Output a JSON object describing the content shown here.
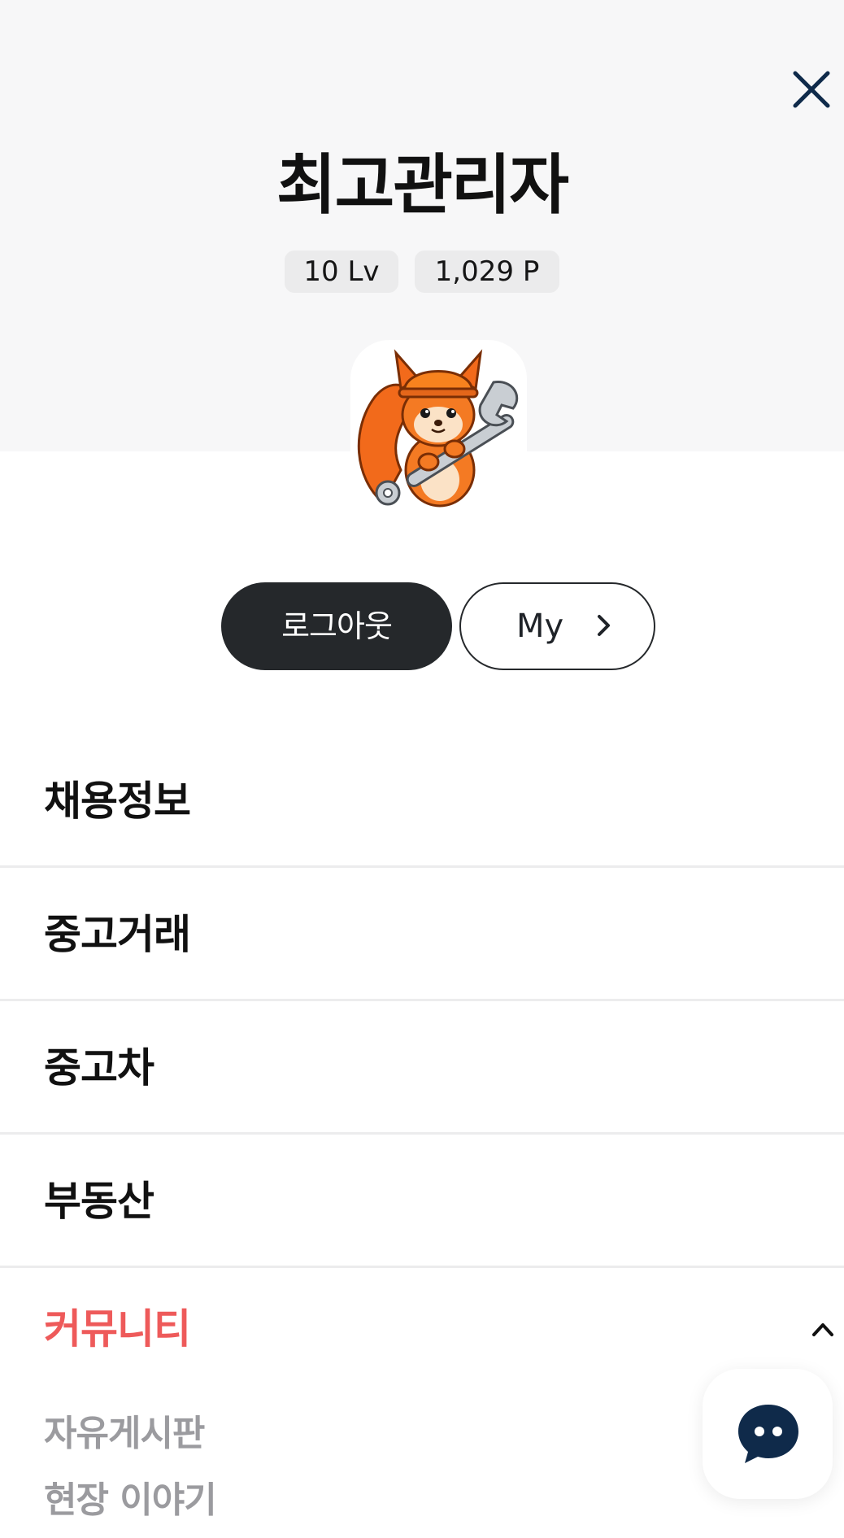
{
  "profile": {
    "username": "최고관리자",
    "level": "10 Lv",
    "points": "1,029 P"
  },
  "actions": {
    "logout_label": "로그아웃",
    "my_label": "My"
  },
  "menu": {
    "items": [
      {
        "label": "채용정보"
      },
      {
        "label": "중고거래"
      },
      {
        "label": "중고차"
      },
      {
        "label": "부동산"
      },
      {
        "label": "커뮤니티"
      }
    ],
    "community_sub": [
      {
        "label": "자유게시판"
      },
      {
        "label": "현장 이야기"
      }
    ]
  },
  "colors": {
    "accent": "#ee5a5a",
    "dark": "#25282b",
    "chat": "#0f2a4a",
    "muted": "#9b9b9f"
  },
  "icons": {
    "close": "close-icon",
    "chevron": "chevron-right-icon",
    "caret": "chevron-up-icon",
    "chat": "chat-bubble-icon",
    "avatar": "squirrel-mascot"
  }
}
